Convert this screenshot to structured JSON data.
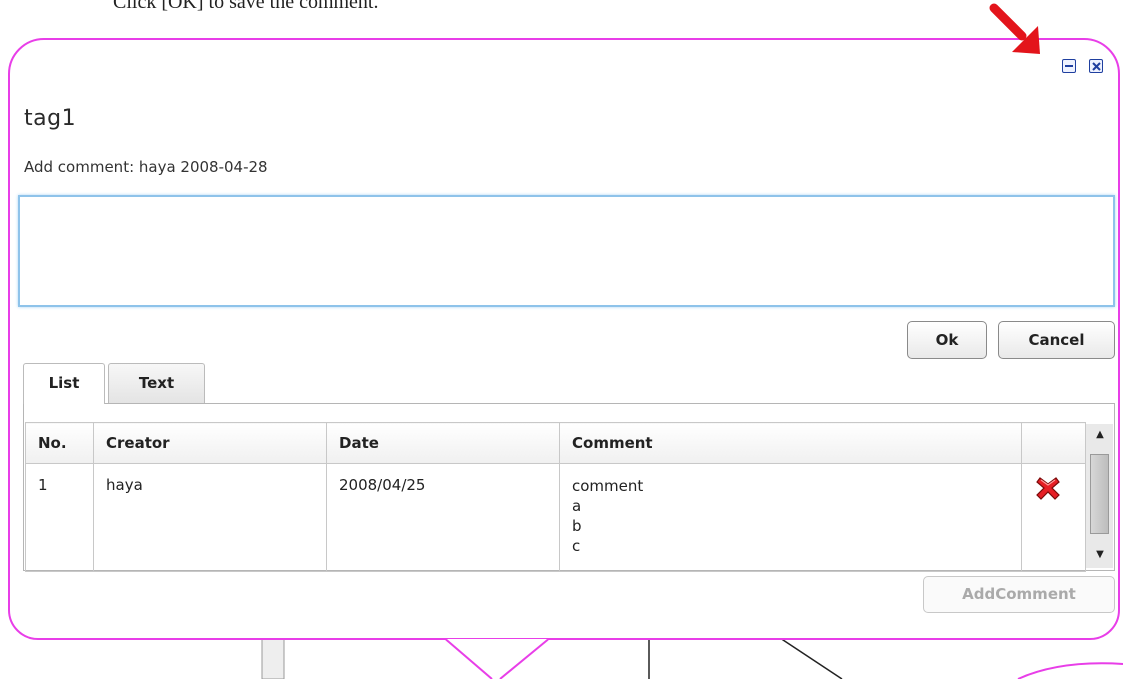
{
  "instruction": "Click [OK] to save the comment.",
  "popup": {
    "title": "tag1",
    "subtitle": "Add comment: haya 2008-04-28",
    "comment_input": {
      "value": ""
    }
  },
  "buttons": {
    "ok": "Ok",
    "cancel": "Cancel",
    "add_comment": "AddComment"
  },
  "tabs": [
    {
      "label": "List",
      "active": true
    },
    {
      "label": "Text",
      "active": false
    }
  ],
  "table": {
    "headers": [
      "No.",
      "Creator",
      "Date",
      "Comment"
    ],
    "rows": [
      {
        "no": "1",
        "creator": "haya",
        "date": "2008/04/25",
        "comment_lines": [
          "comment",
          "a",
          "b",
          "c"
        ],
        "delete_icon": "red-x-delete-icon"
      }
    ]
  },
  "icons": [
    "minimize-icon",
    "close-icon",
    "red-arrow-icon",
    "delete-icon",
    "scroll-up-icon",
    "scroll-down-icon"
  ],
  "colors": {
    "balloon_border": "#e83ee8",
    "input_border": "#8ec3ea",
    "arrow": "#e3141b",
    "window_buttons": "#1f3f9f"
  }
}
